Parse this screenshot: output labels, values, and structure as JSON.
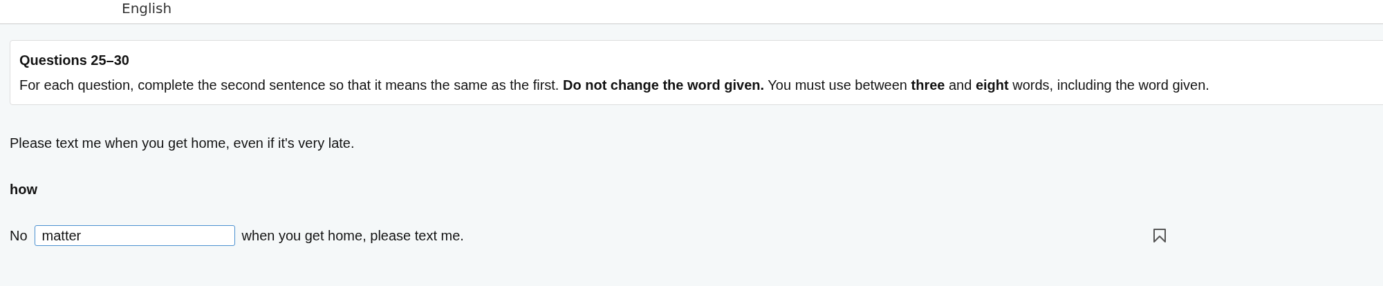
{
  "header": {
    "language": "English"
  },
  "instructions": {
    "title": "Questions 25–30",
    "text": "For each question, complete the second sentence so that it means the same as the first. **Do not change the word given.** You must use between **three** and **eight** words, including the word given."
  },
  "question": {
    "sentence": "Please text me when you get home, even if it's very late.",
    "key_word": "how",
    "before": "No",
    "answer": "matter",
    "after": "when you get home, please text me.",
    "bookmarked": false
  }
}
